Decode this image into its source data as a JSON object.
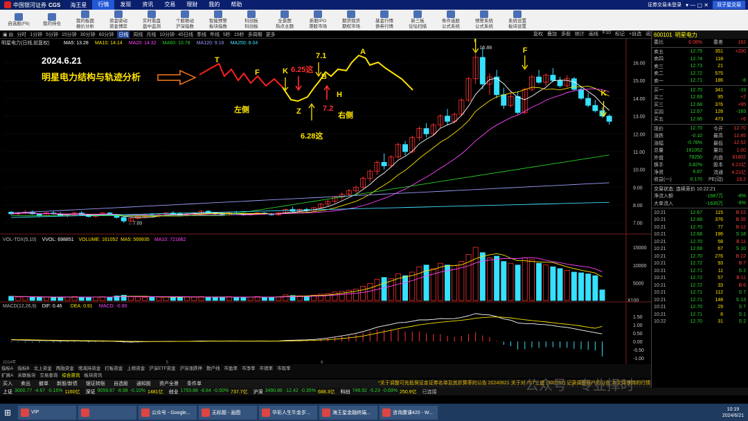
{
  "topbar": {
    "logo": "中国银河证券",
    "brand": "CGS",
    "app": "海王星",
    "menus": [
      "行情",
      "发现",
      "资讯",
      "交易",
      "理财",
      "我的",
      "帮助"
    ],
    "active": "行情",
    "login_hint": "证券交易未登录",
    "login_btn": "双子星交易"
  },
  "toolbar": [
    [
      "自选股(F6)",
      ""
    ],
    [
      "我的持仓",
      ""
    ],
    [
      "我的板面",
      "报价分析"
    ],
    [
      "资金驱动",
      "资金博弈"
    ],
    [
      "实时看盘",
      "盘中监测"
    ],
    [
      "个股联动",
      "沪深指数"
    ],
    [
      "智能预警",
      "板块指数"
    ],
    [
      "科创板",
      "科创板"
    ],
    [
      "全景图",
      "热点主题"
    ],
    [
      "新股IPO",
      "港股市场"
    ],
    [
      "期货现货",
      "期权市场"
    ],
    [
      "基金行情",
      "债券行情"
    ],
    [
      "新三板",
      "论坛扫描"
    ],
    [
      "条件选股",
      "公式系统"
    ],
    [
      "预警系统",
      "公式系统"
    ],
    [
      "系统设置",
      "板块设置"
    ]
  ],
  "periodbar": [
    "分时",
    "1分钟",
    "5分钟",
    "15分钟",
    "30分钟",
    "60分钟",
    "日线",
    "周线",
    "月线",
    "10分钟",
    "45日线",
    "季线",
    "年线",
    "5秒",
    "15秒",
    "多周期",
    "更多"
  ],
  "period_active": "日线",
  "chartbar": [
    "复权",
    "叠加",
    "多股",
    "统计",
    "画线",
    "F10",
    "标记",
    "+自选",
    "返回"
  ],
  "ma_line": {
    "name": "明星电力(日线,前复权)",
    "items": [
      [
        "MA5: 13.28",
        "#ffffff"
      ],
      [
        "MA10: 14.14",
        "#ffe400"
      ],
      [
        "MA20: 14.32",
        "#ff47ff"
      ],
      [
        "MA60: 10.78",
        "#2bd12b"
      ],
      [
        "MA120: 9.16",
        "#9d9dff"
      ],
      [
        "MA250: 8.04",
        "#3ee0ff"
      ]
    ]
  },
  "annotations": {
    "date": "2024.6.21",
    "title": "明星电力结构与轨迹分析",
    "left": "左侧",
    "right": "右侧",
    "T1": "T",
    "F1": "F",
    "K1": "K",
    "Z": "Z",
    "B": "B",
    "H": "H",
    "A": "A",
    "d71": "7.1",
    "d625": "6.25这",
    "d72": "7.2",
    "d628": "6.28这",
    "T2": "T",
    "F2": "F",
    "K2": "K",
    "max_label": "16.88",
    "min_label": "7.00"
  },
  "yaxis": [
    "16.00",
    "15.00",
    "14.00",
    "13.00",
    "12.00",
    "11.00",
    "10.00",
    "9.00",
    "8.00",
    "7.00"
  ],
  "vol_line": {
    "items": [
      [
        "VOL-TDX(5,10)",
        "#bbbbbb"
      ],
      [
        "VVOL: 698851",
        "#ffffff"
      ],
      [
        "VOLUME: 161052",
        "#ffe400"
      ],
      [
        "MA5: 569935",
        "#ffe400"
      ],
      [
        "MA10: 721662",
        "#ff47ff"
      ]
    ]
  },
  "vol_axis": [
    "15000",
    "10000",
    "5000",
    "X100"
  ],
  "macd_line": {
    "items": [
      [
        "MACD(12,26,9)",
        "#bbbbbb"
      ],
      [
        "DIF: 0.46",
        "#ffffff"
      ],
      [
        "DEA: 0.91",
        "#ffe400"
      ],
      [
        "MACD: -0.90",
        "#ff47ff"
      ]
    ]
  },
  "macd_axis": [
    "1.50",
    "1.00",
    "0.50",
    "0.00",
    "-0.50",
    "-1.00"
  ],
  "timeline": [
    "2024年",
    "5",
    "6"
  ],
  "tabs1": [
    "指标A",
    "指标B",
    "北上资金",
    "两融资金",
    "增减持资金",
    "打板资金",
    "上榜资金",
    "沪深ETF资金",
    "沪深涨跌停",
    "散户线",
    "市盈率",
    "市净率",
    "市销率",
    "市现率"
  ],
  "tabs2": [
    "扩展A",
    "关联板块",
    "交易查询",
    "综合资讯",
    "板块资讯"
  ],
  "tabs2_active": "综合资讯",
  "actions": [
    "买入",
    "卖出",
    "撤单",
    "新股/新债",
    "银证转账",
    "自选股",
    "通知股",
    "资产全景",
    "条件单"
  ],
  "news": "*关于调整可充抵保证金证券名单及其折算率的公告 20240621    关于对 *ST三盛 (300782) 记录调整账户的公告    本文件保持的行情",
  "ticker": [
    [
      "上证",
      "3000.77",
      "-4.67",
      "-0.16%",
      "1160亿"
    ],
    [
      "深证",
      "9059.87",
      "-8.98",
      "-0.10%",
      "1481亿"
    ],
    [
      "创业",
      "1753.88",
      "-8.84",
      "-0.50%",
      "737.7亿"
    ],
    [
      "沪深",
      "3490.86",
      "-12.42",
      "-0.35%",
      "688.3亿"
    ],
    [
      "科创",
      "749.92",
      "-5.23",
      "-0.69%",
      "250.9亿"
    ]
  ],
  "ticker_status": "已连接",
  "stock": {
    "code": "600101",
    "name": "明星电力"
  },
  "quote_top": [
    [
      "委比",
      "6.08%",
      "委差",
      "162"
    ]
  ],
  "asks": [
    [
      "卖五",
      "12.75",
      "351",
      "+200"
    ],
    [
      "卖四",
      "12.74",
      "118",
      ""
    ],
    [
      "卖三",
      "12.73",
      "21",
      ""
    ],
    [
      "卖二",
      "12.72",
      "575",
      ""
    ],
    [
      "卖一",
      "12.71",
      "186",
      "-8"
    ]
  ],
  "bids": [
    [
      "买一",
      "12.70",
      "341",
      "-19"
    ],
    [
      "买二",
      "12.69",
      "95",
      "+2"
    ],
    [
      "买三",
      "12.68",
      "376",
      "+95"
    ],
    [
      "买四",
      "12.67",
      "128",
      "-193"
    ],
    [
      "买五",
      "12.66",
      "473",
      "+6"
    ]
  ],
  "quote_info": [
    [
      "现价",
      "12.70",
      "今开",
      "12.70"
    ],
    [
      "涨跌",
      "-0.10",
      "最高",
      "12.85"
    ],
    [
      "涨幅",
      "-0.78%",
      "最低",
      "12.52"
    ],
    [
      "总量",
      "161052",
      "量比",
      "1.00"
    ],
    [
      "外盘",
      "79250",
      "内盘",
      "81802"
    ],
    [
      "换手",
      "3.82%",
      "股本",
      "4.21亿"
    ],
    [
      "净资",
      "6.87",
      "流通",
      "4.21亿"
    ],
    [
      "收益(一)",
      "0.170",
      "PE(动)",
      "19.2"
    ]
  ],
  "auction": "交易状态: 连续竞价 10:22:21",
  "flow": [
    [
      "净流入额",
      "-1687万",
      "-8%"
    ],
    [
      "大单流入",
      "-1635万",
      "-8%"
    ]
  ],
  "ticks": [
    [
      "10:21",
      "12.67",
      "115",
      "B",
      "22"
    ],
    [
      "10:21",
      "12.68",
      "376",
      "B",
      "35"
    ],
    [
      "10:21",
      "12.70",
      "77",
      "B",
      "12"
    ],
    [
      "10:21",
      "12.68",
      "196",
      "S",
      "18"
    ],
    [
      "10:21",
      "12.70",
      "58",
      "B",
      "11"
    ],
    [
      "10:21",
      "12.69",
      "67",
      "S",
      "10"
    ],
    [
      "10:21",
      "12.70",
      "276",
      "B",
      "22"
    ],
    [
      "10:21",
      "12.72",
      "93",
      "B",
      "7"
    ],
    [
      "10:21",
      "12.71",
      "11",
      "S",
      "2"
    ],
    [
      "10:21",
      "12.72",
      "57",
      "B",
      "11"
    ],
    [
      "10:21",
      "12.72",
      "33",
      "B",
      "6"
    ],
    [
      "10:21",
      "12.71",
      "112",
      "S",
      "7"
    ],
    [
      "10:21",
      "12.71",
      "148",
      "S",
      "13"
    ],
    [
      "10:21",
      "12.70",
      "29",
      "S",
      "7"
    ],
    [
      "10:21",
      "12.71",
      "8",
      "S",
      "1"
    ],
    [
      "10:22",
      "12.70",
      "31",
      "S",
      "2"
    ],
    [
      "10:22",
      "12.70",
      "343",
      "S",
      "27"
    ],
    [
      "10:22",
      "12.69",
      "188",
      "S",
      "8"
    ],
    [
      "10:22",
      "12.68",
      "231",
      "S",
      "13"
    ],
    [
      "10:22",
      "12.69",
      "54",
      "S",
      "8"
    ],
    [
      "10:22",
      "12.70",
      "401",
      "S",
      "10"
    ],
    [
      "10:22",
      "12.70",
      "32",
      "S",
      "3"
    ],
    [
      "10:22",
      "12.71",
      "7",
      "B",
      "2"
    ]
  ],
  "taskbar": [
    "VIP",
    "",
    "公众号 - Google...",
    "无标题 - 画图",
    "华彩人生牛金岁...",
    "海王星金融终端...",
    "咨询康课420 - W..."
  ],
  "clock": {
    "time": "10:19",
    "date": "2024/6/21"
  },
  "watermark": "公众号 · 专业择时",
  "chart_data": {
    "type": "candlestick",
    "title": "明星电力(日线,前复权)",
    "ylim": [
      6.6,
      16.8
    ],
    "candles_ohlc": [
      [
        7.6,
        7.65,
        7.45,
        7.5
      ],
      [
        7.5,
        7.6,
        7.4,
        7.55
      ],
      [
        7.55,
        7.7,
        7.5,
        7.6
      ],
      [
        7.6,
        7.7,
        7.45,
        7.5
      ],
      [
        7.5,
        7.55,
        7.35,
        7.4
      ],
      [
        7.4,
        7.6,
        7.35,
        7.55
      ],
      [
        7.55,
        7.65,
        7.45,
        7.5
      ],
      [
        7.5,
        7.6,
        7.35,
        7.4
      ],
      [
        7.4,
        7.5,
        7.3,
        7.45
      ],
      [
        7.45,
        7.6,
        7.4,
        7.55
      ],
      [
        7.55,
        7.65,
        7.4,
        7.45
      ],
      [
        7.45,
        7.5,
        7.3,
        7.35
      ],
      [
        7.35,
        7.5,
        7.3,
        7.45
      ],
      [
        7.45,
        7.6,
        7.4,
        7.55
      ],
      [
        7.55,
        7.6,
        7.4,
        7.45
      ],
      [
        7.45,
        7.5,
        7.25,
        7.3
      ],
      [
        7.3,
        7.35,
        7.0,
        7.1
      ],
      [
        7.1,
        7.3,
        7.0,
        7.25
      ],
      [
        7.25,
        7.4,
        7.2,
        7.35
      ],
      [
        7.35,
        7.5,
        7.3,
        7.45
      ],
      [
        7.45,
        7.55,
        7.35,
        7.4
      ],
      [
        7.4,
        7.5,
        7.3,
        7.45
      ],
      [
        7.45,
        7.6,
        7.4,
        7.55
      ],
      [
        7.55,
        7.65,
        7.45,
        7.5
      ],
      [
        7.5,
        7.6,
        7.4,
        7.45
      ],
      [
        7.45,
        7.55,
        7.35,
        7.5
      ],
      [
        7.5,
        7.6,
        7.45,
        7.55
      ],
      [
        7.55,
        7.7,
        7.5,
        7.65
      ],
      [
        7.65,
        7.7,
        7.5,
        7.55
      ],
      [
        7.55,
        7.6,
        7.45,
        7.5
      ],
      [
        7.5,
        7.6,
        7.4,
        7.45
      ],
      [
        7.45,
        7.6,
        7.4,
        7.55
      ],
      [
        7.55,
        7.65,
        7.45,
        7.5
      ],
      [
        7.5,
        7.55,
        7.4,
        7.45
      ],
      [
        7.45,
        7.55,
        7.4,
        7.5
      ],
      [
        7.5,
        7.6,
        7.45,
        7.55
      ],
      [
        7.55,
        7.6,
        7.45,
        7.5
      ],
      [
        7.5,
        7.55,
        7.4,
        7.45
      ],
      [
        7.45,
        7.6,
        7.4,
        7.55
      ],
      [
        7.55,
        7.8,
        7.5,
        7.75
      ],
      [
        7.75,
        7.9,
        7.6,
        7.65
      ],
      [
        7.65,
        7.8,
        7.6,
        7.75
      ],
      [
        7.75,
        7.85,
        7.6,
        7.7
      ],
      [
        7.7,
        7.9,
        7.65,
        7.85
      ],
      [
        7.85,
        8.1,
        7.8,
        8.05
      ],
      [
        8.05,
        8.3,
        7.95,
        8.2
      ],
      [
        8.2,
        8.5,
        8.1,
        8.45
      ],
      [
        8.45,
        8.7,
        8.3,
        8.6
      ],
      [
        8.6,
        8.9,
        8.5,
        8.8
      ],
      [
        8.8,
        9.1,
        8.7,
        9.0
      ],
      [
        9.0,
        9.6,
        8.9,
        9.5
      ],
      [
        9.5,
        10.0,
        9.3,
        9.9
      ],
      [
        9.9,
        10.5,
        9.7,
        10.4
      ],
      [
        10.4,
        10.9,
        10.0,
        10.2
      ],
      [
        10.2,
        10.8,
        10.1,
        10.7
      ],
      [
        10.7,
        11.5,
        10.6,
        11.4
      ],
      [
        11.4,
        11.6,
        10.8,
        11.0
      ],
      [
        11.0,
        11.9,
        10.9,
        11.8
      ],
      [
        11.8,
        12.4,
        11.6,
        12.3
      ],
      [
        12.3,
        12.6,
        11.8,
        12.0
      ],
      [
        12.0,
        12.6,
        11.9,
        12.5
      ],
      [
        12.5,
        13.1,
        12.3,
        13.0
      ],
      [
        13.0,
        13.4,
        12.5,
        12.7
      ],
      [
        12.7,
        13.2,
        12.6,
        13.1
      ],
      [
        13.1,
        14.0,
        13.0,
        13.9
      ],
      [
        13.9,
        15.2,
        13.8,
        15.1
      ],
      [
        15.1,
        16.5,
        14.8,
        16.3
      ],
      [
        16.3,
        16.88,
        14.5,
        14.8
      ],
      [
        14.8,
        15.4,
        14.2,
        15.2
      ],
      [
        15.2,
        15.6,
        14.0,
        14.2
      ],
      [
        14.2,
        14.6,
        13.4,
        13.6
      ],
      [
        13.6,
        14.3,
        13.5,
        14.1
      ],
      [
        14.1,
        14.4,
        13.1,
        13.2
      ],
      [
        13.2,
        14.6,
        13.1,
        14.5
      ],
      [
        14.5,
        15.3,
        14.4,
        15.2
      ],
      [
        15.2,
        15.6,
        14.8,
        14.9
      ],
      [
        14.9,
        15.4,
        14.7,
        15.3
      ],
      [
        15.3,
        15.7,
        14.9,
        15.0
      ],
      [
        15.0,
        15.2,
        14.6,
        14.7
      ],
      [
        14.7,
        15.3,
        14.6,
        15.1
      ],
      [
        15.1,
        15.2,
        14.4,
        14.5
      ],
      [
        14.5,
        14.7,
        13.9,
        14.0
      ],
      [
        14.0,
        14.3,
        13.5,
        13.6
      ],
      [
        13.6,
        13.9,
        13.2,
        13.3
      ],
      [
        13.3,
        13.5,
        12.9,
        13.0
      ],
      [
        13.0,
        13.1,
        12.52,
        12.7
      ]
    ],
    "volume": [
      1200,
      1000,
      1100,
      900,
      950,
      1000,
      900,
      950,
      1000,
      1100,
      900,
      950,
      1000,
      1050,
      900,
      1300,
      1500,
      1200,
      1000,
      900,
      950,
      1000,
      1100,
      900,
      950,
      1000,
      1050,
      1100,
      950,
      900,
      1000,
      1050,
      950,
      900,
      1000,
      1100,
      900,
      950,
      1050,
      1600,
      1400,
      1300,
      1200,
      1500,
      1800,
      2000,
      2400,
      2600,
      2900,
      3200,
      4000,
      4800,
      6000,
      6500,
      6200,
      7500,
      7000,
      8000,
      9500,
      10000,
      9000,
      10500,
      10000,
      9800,
      11000,
      13000,
      15000,
      13500,
      12000,
      12500,
      11000,
      10500,
      10000,
      12000,
      11500,
      10500,
      10000,
      9500,
      9000,
      8500,
      8000,
      7800,
      7500,
      7000,
      3000
    ],
    "macd_dif": [
      0.1,
      0.09,
      0.08,
      0.07,
      0.06,
      0.06,
      0.05,
      0.04,
      0.04,
      0.04,
      0.03,
      0.02,
      0.02,
      0.02,
      0.02,
      0.01,
      -0.02,
      -0.03,
      -0.02,
      -0.01,
      0.0,
      0.0,
      0.01,
      0.01,
      0.01,
      0.01,
      0.02,
      0.03,
      0.03,
      0.03,
      0.02,
      0.03,
      0.03,
      0.02,
      0.02,
      0.03,
      0.03,
      0.02,
      0.03,
      0.06,
      0.08,
      0.09,
      0.1,
      0.12,
      0.16,
      0.21,
      0.27,
      0.34,
      0.41,
      0.49,
      0.6,
      0.72,
      0.86,
      0.95,
      1.03,
      1.13,
      1.15,
      1.22,
      1.3,
      1.3,
      1.33,
      1.38,
      1.37,
      1.38,
      1.45,
      1.55,
      1.68,
      1.62,
      1.6,
      1.5,
      1.36,
      1.28,
      1.12,
      1.08,
      1.08,
      1.03,
      1.01,
      0.96,
      0.89,
      0.85,
      0.77,
      0.69,
      0.61,
      0.53,
      0.46
    ],
    "macd_dea": [
      0.12,
      0.11,
      0.11,
      0.1,
      0.09,
      0.08,
      0.08,
      0.07,
      0.06,
      0.06,
      0.05,
      0.05,
      0.04,
      0.04,
      0.03,
      0.03,
      0.02,
      0.01,
      0.01,
      0.0,
      0.0,
      0.0,
      0.0,
      0.0,
      0.01,
      0.01,
      0.01,
      0.01,
      0.02,
      0.02,
      0.02,
      0.02,
      0.02,
      0.02,
      0.02,
      0.02,
      0.02,
      0.02,
      0.02,
      0.03,
      0.04,
      0.05,
      0.06,
      0.07,
      0.09,
      0.11,
      0.14,
      0.18,
      0.22,
      0.27,
      0.33,
      0.41,
      0.5,
      0.59,
      0.68,
      0.77,
      0.85,
      0.92,
      1.0,
      1.06,
      1.11,
      1.16,
      1.2,
      1.24,
      1.28,
      1.33,
      1.4,
      1.44,
      1.47,
      1.48,
      1.46,
      1.42,
      1.36,
      1.31,
      1.26,
      1.22,
      1.18,
      1.13,
      1.08,
      1.04,
      0.99,
      0.93,
      0.86,
      0.8,
      0.91
    ],
    "series": [
      {
        "name": "MA5",
        "color": "#ffffff"
      },
      {
        "name": "MA10",
        "color": "#ffe400"
      },
      {
        "name": "MA20",
        "color": "#ff47ff"
      },
      {
        "name": "MA60",
        "color": "#2bd12b"
      },
      {
        "name": "MA120",
        "color": "#9d9dff"
      },
      {
        "name": "MA250",
        "color": "#3ee0ff"
      }
    ],
    "xlabel": "",
    "ylabel": ""
  }
}
